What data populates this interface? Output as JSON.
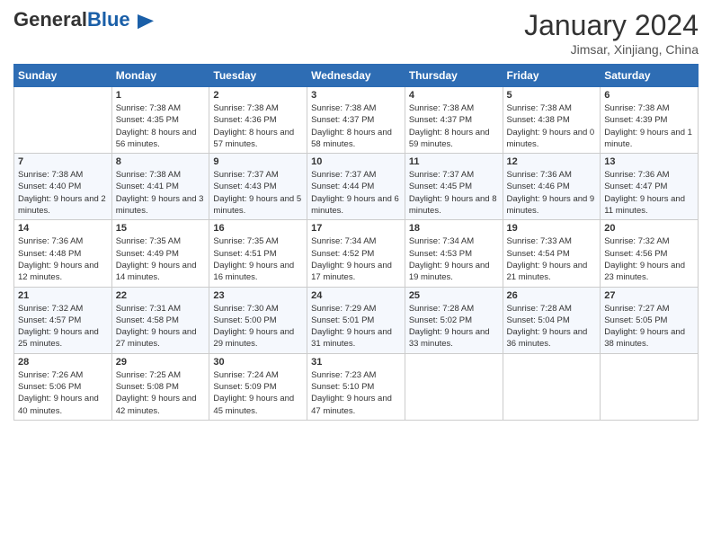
{
  "header": {
    "logo_general": "General",
    "logo_blue": "Blue",
    "month_title": "January 2024",
    "location": "Jimsar, Xinjiang, China"
  },
  "weekdays": [
    "Sunday",
    "Monday",
    "Tuesday",
    "Wednesday",
    "Thursday",
    "Friday",
    "Saturday"
  ],
  "weeks": [
    [
      {
        "day": "",
        "sunrise": "",
        "sunset": "",
        "daylight": ""
      },
      {
        "day": "1",
        "sunrise": "Sunrise: 7:38 AM",
        "sunset": "Sunset: 4:35 PM",
        "daylight": "Daylight: 8 hours and 56 minutes."
      },
      {
        "day": "2",
        "sunrise": "Sunrise: 7:38 AM",
        "sunset": "Sunset: 4:36 PM",
        "daylight": "Daylight: 8 hours and 57 minutes."
      },
      {
        "day": "3",
        "sunrise": "Sunrise: 7:38 AM",
        "sunset": "Sunset: 4:37 PM",
        "daylight": "Daylight: 8 hours and 58 minutes."
      },
      {
        "day": "4",
        "sunrise": "Sunrise: 7:38 AM",
        "sunset": "Sunset: 4:37 PM",
        "daylight": "Daylight: 8 hours and 59 minutes."
      },
      {
        "day": "5",
        "sunrise": "Sunrise: 7:38 AM",
        "sunset": "Sunset: 4:38 PM",
        "daylight": "Daylight: 9 hours and 0 minutes."
      },
      {
        "day": "6",
        "sunrise": "Sunrise: 7:38 AM",
        "sunset": "Sunset: 4:39 PM",
        "daylight": "Daylight: 9 hours and 1 minute."
      }
    ],
    [
      {
        "day": "7",
        "sunrise": "Sunrise: 7:38 AM",
        "sunset": "Sunset: 4:40 PM",
        "daylight": "Daylight: 9 hours and 2 minutes."
      },
      {
        "day": "8",
        "sunrise": "Sunrise: 7:38 AM",
        "sunset": "Sunset: 4:41 PM",
        "daylight": "Daylight: 9 hours and 3 minutes."
      },
      {
        "day": "9",
        "sunrise": "Sunrise: 7:37 AM",
        "sunset": "Sunset: 4:43 PM",
        "daylight": "Daylight: 9 hours and 5 minutes."
      },
      {
        "day": "10",
        "sunrise": "Sunrise: 7:37 AM",
        "sunset": "Sunset: 4:44 PM",
        "daylight": "Daylight: 9 hours and 6 minutes."
      },
      {
        "day": "11",
        "sunrise": "Sunrise: 7:37 AM",
        "sunset": "Sunset: 4:45 PM",
        "daylight": "Daylight: 9 hours and 8 minutes."
      },
      {
        "day": "12",
        "sunrise": "Sunrise: 7:36 AM",
        "sunset": "Sunset: 4:46 PM",
        "daylight": "Daylight: 9 hours and 9 minutes."
      },
      {
        "day": "13",
        "sunrise": "Sunrise: 7:36 AM",
        "sunset": "Sunset: 4:47 PM",
        "daylight": "Daylight: 9 hours and 11 minutes."
      }
    ],
    [
      {
        "day": "14",
        "sunrise": "Sunrise: 7:36 AM",
        "sunset": "Sunset: 4:48 PM",
        "daylight": "Daylight: 9 hours and 12 minutes."
      },
      {
        "day": "15",
        "sunrise": "Sunrise: 7:35 AM",
        "sunset": "Sunset: 4:49 PM",
        "daylight": "Daylight: 9 hours and 14 minutes."
      },
      {
        "day": "16",
        "sunrise": "Sunrise: 7:35 AM",
        "sunset": "Sunset: 4:51 PM",
        "daylight": "Daylight: 9 hours and 16 minutes."
      },
      {
        "day": "17",
        "sunrise": "Sunrise: 7:34 AM",
        "sunset": "Sunset: 4:52 PM",
        "daylight": "Daylight: 9 hours and 17 minutes."
      },
      {
        "day": "18",
        "sunrise": "Sunrise: 7:34 AM",
        "sunset": "Sunset: 4:53 PM",
        "daylight": "Daylight: 9 hours and 19 minutes."
      },
      {
        "day": "19",
        "sunrise": "Sunrise: 7:33 AM",
        "sunset": "Sunset: 4:54 PM",
        "daylight": "Daylight: 9 hours and 21 minutes."
      },
      {
        "day": "20",
        "sunrise": "Sunrise: 7:32 AM",
        "sunset": "Sunset: 4:56 PM",
        "daylight": "Daylight: 9 hours and 23 minutes."
      }
    ],
    [
      {
        "day": "21",
        "sunrise": "Sunrise: 7:32 AM",
        "sunset": "Sunset: 4:57 PM",
        "daylight": "Daylight: 9 hours and 25 minutes."
      },
      {
        "day": "22",
        "sunrise": "Sunrise: 7:31 AM",
        "sunset": "Sunset: 4:58 PM",
        "daylight": "Daylight: 9 hours and 27 minutes."
      },
      {
        "day": "23",
        "sunrise": "Sunrise: 7:30 AM",
        "sunset": "Sunset: 5:00 PM",
        "daylight": "Daylight: 9 hours and 29 minutes."
      },
      {
        "day": "24",
        "sunrise": "Sunrise: 7:29 AM",
        "sunset": "Sunset: 5:01 PM",
        "daylight": "Daylight: 9 hours and 31 minutes."
      },
      {
        "day": "25",
        "sunrise": "Sunrise: 7:28 AM",
        "sunset": "Sunset: 5:02 PM",
        "daylight": "Daylight: 9 hours and 33 minutes."
      },
      {
        "day": "26",
        "sunrise": "Sunrise: 7:28 AM",
        "sunset": "Sunset: 5:04 PM",
        "daylight": "Daylight: 9 hours and 36 minutes."
      },
      {
        "day": "27",
        "sunrise": "Sunrise: 7:27 AM",
        "sunset": "Sunset: 5:05 PM",
        "daylight": "Daylight: 9 hours and 38 minutes."
      }
    ],
    [
      {
        "day": "28",
        "sunrise": "Sunrise: 7:26 AM",
        "sunset": "Sunset: 5:06 PM",
        "daylight": "Daylight: 9 hours and 40 minutes."
      },
      {
        "day": "29",
        "sunrise": "Sunrise: 7:25 AM",
        "sunset": "Sunset: 5:08 PM",
        "daylight": "Daylight: 9 hours and 42 minutes."
      },
      {
        "day": "30",
        "sunrise": "Sunrise: 7:24 AM",
        "sunset": "Sunset: 5:09 PM",
        "daylight": "Daylight: 9 hours and 45 minutes."
      },
      {
        "day": "31",
        "sunrise": "Sunrise: 7:23 AM",
        "sunset": "Sunset: 5:10 PM",
        "daylight": "Daylight: 9 hours and 47 minutes."
      },
      {
        "day": "",
        "sunrise": "",
        "sunset": "",
        "daylight": ""
      },
      {
        "day": "",
        "sunrise": "",
        "sunset": "",
        "daylight": ""
      },
      {
        "day": "",
        "sunrise": "",
        "sunset": "",
        "daylight": ""
      }
    ]
  ]
}
